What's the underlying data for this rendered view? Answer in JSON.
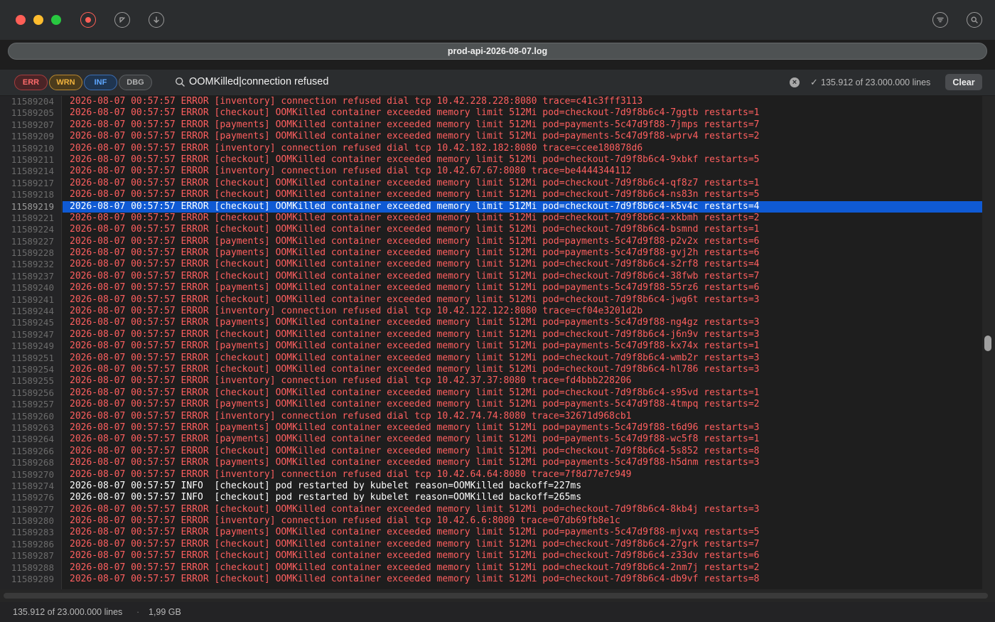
{
  "window": {
    "file_title": "prod-api-2026-08-07.log",
    "toolbar_icons": [
      "record-icon",
      "jump-to-start-icon",
      "tail-follow-icon",
      "filter-icon",
      "search-icon"
    ]
  },
  "filters": {
    "levels": [
      {
        "label": "ERR",
        "color": "#ff6b6b",
        "active": true
      },
      {
        "label": "WRN",
        "color": "#f1b33d",
        "active": true
      },
      {
        "label": "INF",
        "color": "#5ea7ff",
        "active": true
      },
      {
        "label": "DBG",
        "color": "#b0b0b0",
        "active": false
      }
    ],
    "query": "OOMKilled|connection refused",
    "match_check": "✓",
    "match_count": "135.912 of 23.000.000 lines",
    "clear_label": "Clear"
  },
  "colors": {
    "error": "#ff5f5f",
    "info": "#ffffff",
    "selection": "#0f5ad4"
  },
  "log": {
    "lines": [
      {
        "num": "11589204",
        "level": "error",
        "text": "2026-08-07 00:57:57 ERROR [inventory] connection refused dial tcp 10.42.228.228:8080 trace=c41c3fff3113"
      },
      {
        "num": "11589205",
        "level": "error",
        "text": "2026-08-07 00:57:57 ERROR [checkout] OOMKilled container exceeded memory limit 512Mi pod=checkout-7d9f8b6c4-7ggtb restarts=1"
      },
      {
        "num": "11589207",
        "level": "error",
        "text": "2026-08-07 00:57:57 ERROR [payments] OOMKilled container exceeded memory limit 512Mi pod=payments-5c47d9f88-7jmps restarts=7"
      },
      {
        "num": "11589209",
        "level": "error",
        "text": "2026-08-07 00:57:57 ERROR [payments] OOMKilled container exceeded memory limit 512Mi pod=payments-5c47d9f88-wprv4 restarts=2"
      },
      {
        "num": "11589210",
        "level": "error",
        "text": "2026-08-07 00:57:57 ERROR [inventory] connection refused dial tcp 10.42.182.182:8080 trace=ccee180878d6"
      },
      {
        "num": "11589211",
        "level": "error",
        "text": "2026-08-07 00:57:57 ERROR [checkout] OOMKilled container exceeded memory limit 512Mi pod=checkout-7d9f8b6c4-9xbkf restarts=5"
      },
      {
        "num": "11589214",
        "level": "error",
        "text": "2026-08-07 00:57:57 ERROR [inventory] connection refused dial tcp 10.42.67.67:8080 trace=be4444344112"
      },
      {
        "num": "11589217",
        "level": "error",
        "text": "2026-08-07 00:57:57 ERROR [checkout] OOMKilled container exceeded memory limit 512Mi pod=checkout-7d9f8b6c4-qf8z7 restarts=1"
      },
      {
        "num": "11589218",
        "level": "error",
        "text": "2026-08-07 00:57:57 ERROR [checkout] OOMKilled container exceeded memory limit 512Mi pod=checkout-7d9f8b6c4-ns83n restarts=5"
      },
      {
        "num": "11589219",
        "level": "error",
        "selected": true,
        "text": "2026-08-07 00:57:57 ERROR [checkout] OOMKilled container exceeded memory limit 512Mi pod=checkout-7d9f8b6c4-k5v4c restarts=4"
      },
      {
        "num": "11589221",
        "level": "error",
        "text": "2026-08-07 00:57:57 ERROR [checkout] OOMKilled container exceeded memory limit 512Mi pod=checkout-7d9f8b6c4-xkbmh restarts=2"
      },
      {
        "num": "11589224",
        "level": "error",
        "text": "2026-08-07 00:57:57 ERROR [checkout] OOMKilled container exceeded memory limit 512Mi pod=checkout-7d9f8b6c4-bsmnd restarts=1"
      },
      {
        "num": "11589227",
        "level": "error",
        "text": "2026-08-07 00:57:57 ERROR [payments] OOMKilled container exceeded memory limit 512Mi pod=payments-5c47d9f88-p2v2x restarts=6"
      },
      {
        "num": "11589228",
        "level": "error",
        "text": "2026-08-07 00:57:57 ERROR [payments] OOMKilled container exceeded memory limit 512Mi pod=payments-5c47d9f88-gvj2h restarts=6"
      },
      {
        "num": "11589232",
        "level": "error",
        "text": "2026-08-07 00:57:57 ERROR [checkout] OOMKilled container exceeded memory limit 512Mi pod=checkout-7d9f8b6c4-s2rf8 restarts=4"
      },
      {
        "num": "11589237",
        "level": "error",
        "text": "2026-08-07 00:57:57 ERROR [checkout] OOMKilled container exceeded memory limit 512Mi pod=checkout-7d9f8b6c4-38fwb restarts=7"
      },
      {
        "num": "11589240",
        "level": "error",
        "text": "2026-08-07 00:57:57 ERROR [payments] OOMKilled container exceeded memory limit 512Mi pod=payments-5c47d9f88-55rz6 restarts=6"
      },
      {
        "num": "11589241",
        "level": "error",
        "text": "2026-08-07 00:57:57 ERROR [checkout] OOMKilled container exceeded memory limit 512Mi pod=checkout-7d9f8b6c4-jwg6t restarts=3"
      },
      {
        "num": "11589244",
        "level": "error",
        "text": "2026-08-07 00:57:57 ERROR [inventory] connection refused dial tcp 10.42.122.122:8080 trace=cf04e3201d2b"
      },
      {
        "num": "11589245",
        "level": "error",
        "text": "2026-08-07 00:57:57 ERROR [payments] OOMKilled container exceeded memory limit 512Mi pod=payments-5c47d9f88-ng4gz restarts=3"
      },
      {
        "num": "11589247",
        "level": "error",
        "text": "2026-08-07 00:57:57 ERROR [checkout] OOMKilled container exceeded memory limit 512Mi pod=checkout-7d9f8b6c4-j6n9v restarts=3"
      },
      {
        "num": "11589249",
        "level": "error",
        "text": "2026-08-07 00:57:57 ERROR [payments] OOMKilled container exceeded memory limit 512Mi pod=payments-5c47d9f88-kx74x restarts=1"
      },
      {
        "num": "11589251",
        "level": "error",
        "text": "2026-08-07 00:57:57 ERROR [checkout] OOMKilled container exceeded memory limit 512Mi pod=checkout-7d9f8b6c4-wmb2r restarts=3"
      },
      {
        "num": "11589254",
        "level": "error",
        "text": "2026-08-07 00:57:57 ERROR [checkout] OOMKilled container exceeded memory limit 512Mi pod=checkout-7d9f8b6c4-hl786 restarts=3"
      },
      {
        "num": "11589255",
        "level": "error",
        "text": "2026-08-07 00:57:57 ERROR [inventory] connection refused dial tcp 10.42.37.37:8080 trace=fd4bbb228206"
      },
      {
        "num": "11589256",
        "level": "error",
        "text": "2026-08-07 00:57:57 ERROR [checkout] OOMKilled container exceeded memory limit 512Mi pod=checkout-7d9f8b6c4-s95vd restarts=1"
      },
      {
        "num": "11589257",
        "level": "error",
        "text": "2026-08-07 00:57:57 ERROR [payments] OOMKilled container exceeded memory limit 512Mi pod=payments-5c47d9f88-4tmpq restarts=2"
      },
      {
        "num": "11589260",
        "level": "error",
        "text": "2026-08-07 00:57:57 ERROR [inventory] connection refused dial tcp 10.42.74.74:8080 trace=32671d968cb1"
      },
      {
        "num": "11589263",
        "level": "error",
        "text": "2026-08-07 00:57:57 ERROR [payments] OOMKilled container exceeded memory limit 512Mi pod=payments-5c47d9f88-t6d96 restarts=3"
      },
      {
        "num": "11589264",
        "level": "error",
        "text": "2026-08-07 00:57:57 ERROR [payments] OOMKilled container exceeded memory limit 512Mi pod=payments-5c47d9f88-wc5f8 restarts=1"
      },
      {
        "num": "11589266",
        "level": "error",
        "text": "2026-08-07 00:57:57 ERROR [checkout] OOMKilled container exceeded memory limit 512Mi pod=checkout-7d9f8b6c4-5s852 restarts=8"
      },
      {
        "num": "11589268",
        "level": "error",
        "text": "2026-08-07 00:57:57 ERROR [payments] OOMKilled container exceeded memory limit 512Mi pod=payments-5c47d9f88-h5dnm restarts=3"
      },
      {
        "num": "11589270",
        "level": "error",
        "text": "2026-08-07 00:57:57 ERROR [inventory] connection refused dial tcp 10.42.64.64:8080 trace=7f8d77e7c949"
      },
      {
        "num": "11589274",
        "level": "info",
        "text": "2026-08-07 00:57:57 INFO  [checkout] pod restarted by kubelet reason=OOMKilled backoff=227ms"
      },
      {
        "num": "11589276",
        "level": "info",
        "text": "2026-08-07 00:57:57 INFO  [checkout] pod restarted by kubelet reason=OOMKilled backoff=265ms"
      },
      {
        "num": "11589277",
        "level": "error",
        "text": "2026-08-07 00:57:57 ERROR [checkout] OOMKilled container exceeded memory limit 512Mi pod=checkout-7d9f8b6c4-8kb4j restarts=3"
      },
      {
        "num": "11589280",
        "level": "error",
        "text": "2026-08-07 00:57:57 ERROR [inventory] connection refused dial tcp 10.42.6.6:8080 trace=07db69fb8e1c"
      },
      {
        "num": "11589283",
        "level": "error",
        "text": "2026-08-07 00:57:57 ERROR [payments] OOMKilled container exceeded memory limit 512Mi pod=payments-5c47d9f88-mjvxq restarts=5"
      },
      {
        "num": "11589286",
        "level": "error",
        "text": "2026-08-07 00:57:57 ERROR [checkout] OOMKilled container exceeded memory limit 512Mi pod=checkout-7d9f8b6c4-27grk restarts=7"
      },
      {
        "num": "11589287",
        "level": "error",
        "text": "2026-08-07 00:57:57 ERROR [checkout] OOMKilled container exceeded memory limit 512Mi pod=checkout-7d9f8b6c4-z33dv restarts=6"
      },
      {
        "num": "11589288",
        "level": "error",
        "text": "2026-08-07 00:57:57 ERROR [checkout] OOMKilled container exceeded memory limit 512Mi pod=checkout-7d9f8b6c4-2nm7j restarts=2"
      },
      {
        "num": "11589289",
        "level": "error",
        "text": "2026-08-07 00:57:57 ERROR [checkout] OOMKilled container exceeded memory limit 512Mi pod=checkout-7d9f8b6c4-db9vf restarts=8"
      }
    ]
  },
  "status": {
    "lines": "135.912 of 23.000.000 lines",
    "separator": "·",
    "size": "1,99 GB"
  }
}
